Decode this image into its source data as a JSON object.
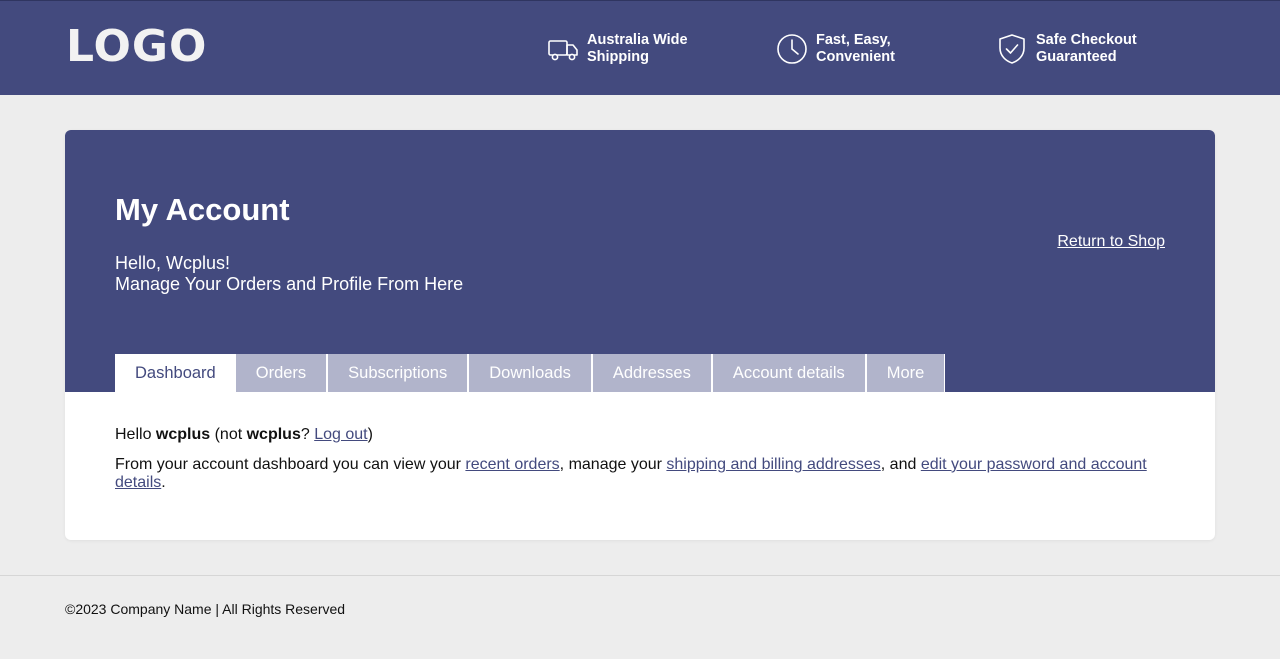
{
  "header": {
    "logo": "LOGO",
    "features": [
      {
        "icon": "truck-icon",
        "text": "Australia Wide\nShipping"
      },
      {
        "icon": "clock-icon",
        "text": "Fast, Easy,\nConvenient"
      },
      {
        "icon": "shield-check-icon",
        "text": "Safe Checkout\nGuaranteed"
      }
    ]
  },
  "account": {
    "title": "My Account",
    "greeting": "Hello, Wcplus!",
    "subgreeting": "Manage Your Orders and Profile From Here",
    "return_link": "Return to Shop",
    "tabs": [
      {
        "label": "Dashboard",
        "active": true
      },
      {
        "label": "Orders"
      },
      {
        "label": "Subscriptions"
      },
      {
        "label": "Downloads"
      },
      {
        "label": "Addresses"
      },
      {
        "label": "Account details"
      },
      {
        "label": "More"
      }
    ]
  },
  "dashboard": {
    "hello_prefix": "Hello ",
    "username": "wcplus",
    "not_prefix": " (not ",
    "not_username": "wcplus",
    "question": "? ",
    "logout_link": "Log out",
    "close_paren": ")",
    "intro_text": "From your account dashboard you can view your ",
    "recent_orders_link": "recent orders",
    "mid_text_1": ", manage your ",
    "addresses_link": "shipping and billing addresses",
    "mid_text_2": ", and ",
    "edit_link": "edit your password and account details",
    "end_text": "."
  },
  "footer": {
    "copyright": "©2023 Company Name | All Rights Reserved"
  },
  "colors": {
    "brand": "#434a7e",
    "tab_inactive": "#b1b4cb",
    "page_bg": "#ededed"
  }
}
